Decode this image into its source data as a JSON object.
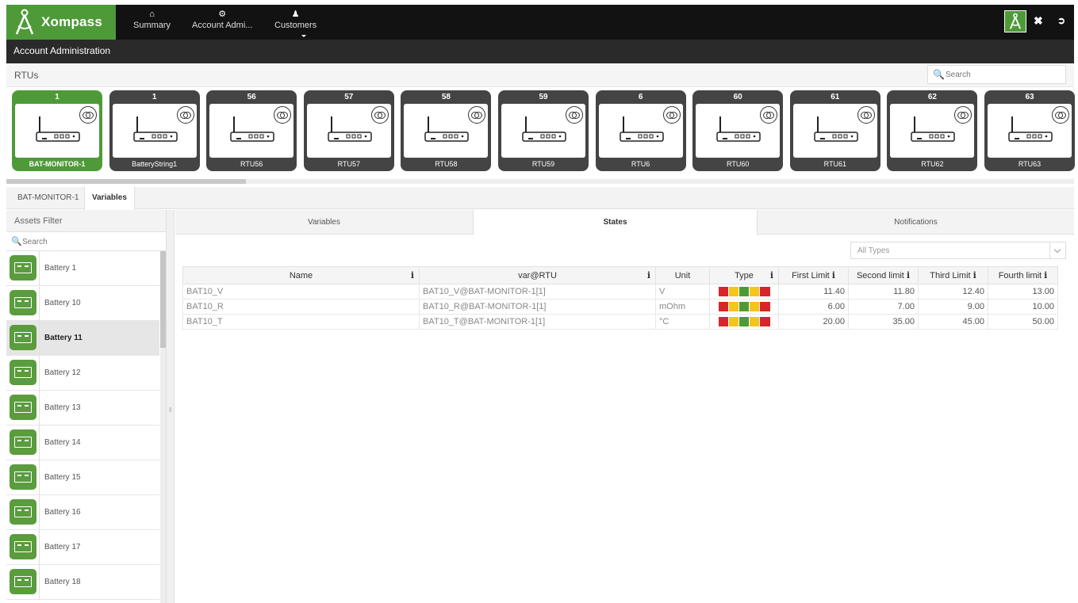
{
  "app": {
    "brand": "Xompass",
    "nav": [
      {
        "label": "Summary",
        "icon": "home-icon"
      },
      {
        "label": "Account Admi...",
        "icon": "gear-icon"
      },
      {
        "label": "Customers",
        "icon": "user-icon"
      }
    ]
  },
  "header": {
    "section_title": "Account Administration"
  },
  "rtus": {
    "title": "RTUs",
    "search_placeholder": "Search",
    "cards": [
      {
        "number": "1",
        "name": "BAT-MONITOR-1",
        "active": true
      },
      {
        "number": "1",
        "name": "BatteryString1"
      },
      {
        "number": "56",
        "name": "RTU56"
      },
      {
        "number": "57",
        "name": "RTU57"
      },
      {
        "number": "58",
        "name": "RTU58"
      },
      {
        "number": "59",
        "name": "RTU59"
      },
      {
        "number": "6",
        "name": "RTU6"
      },
      {
        "number": "60",
        "name": "RTU60"
      },
      {
        "number": "61",
        "name": "RTU61"
      },
      {
        "number": "62",
        "name": "RTU62"
      },
      {
        "number": "63",
        "name": "RTU63"
      }
    ]
  },
  "breadcrumb": {
    "items": [
      "BAT-MONITOR-1",
      "Variables"
    ]
  },
  "assets_filter": {
    "title": "Assets Filter",
    "search_placeholder": "Search",
    "items": [
      "Battery 1",
      "Battery 10",
      "Battery 11",
      "Battery 12",
      "Battery 13",
      "Battery 14",
      "Battery 15",
      "Battery 16",
      "Battery 17",
      "Battery 18"
    ],
    "selected": "Battery 11"
  },
  "main": {
    "tabs": [
      "Variables",
      "States",
      "Notifications"
    ],
    "active_tab": "States",
    "type_filter": "All Types",
    "columns": [
      "Name",
      "var@RTU",
      "Unit",
      "Type",
      "First Limit",
      "Second limit",
      "Third Limit",
      "Fourth limit"
    ],
    "rows": [
      {
        "name": "BAT10_V",
        "var": "BAT10_V@BAT-MONITOR-1[1]",
        "unit": "V",
        "l1": "11.40",
        "l2": "11.80",
        "l3": "12.40",
        "l4": "13.00"
      },
      {
        "name": "BAT10_R",
        "var": "BAT10_R@BAT-MONITOR-1[1]",
        "unit": "mOhm",
        "l1": "6.00",
        "l2": "7.00",
        "l3": "9.00",
        "l4": "10.00"
      },
      {
        "name": "BAT10_T",
        "var": "BAT10_T@BAT-MONITOR-1[1]",
        "unit": "°C",
        "l1": "20.00",
        "l2": "35.00",
        "l3": "45.00",
        "l4": "50.00"
      }
    ],
    "type_colors": [
      "#d9252a",
      "#f5c51b",
      "#4e9a38",
      "#f5c51b",
      "#d9252a"
    ]
  },
  "colors": {
    "brand_green": "#4e9a38",
    "topbar": "#121212",
    "rtu_card": "#444444"
  }
}
